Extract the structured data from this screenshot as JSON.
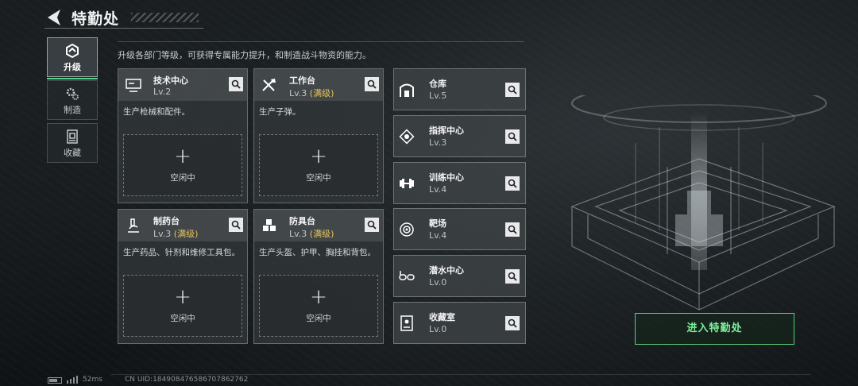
{
  "header": {
    "title": "特勤处"
  },
  "nav": [
    {
      "label": "升级",
      "icon": "upgrade-icon",
      "active": true
    },
    {
      "label": "制造",
      "icon": "gears-icon",
      "active": false
    },
    {
      "label": "收藏",
      "icon": "collection-icon",
      "active": false
    }
  ],
  "description": "升级各部门等级，可获得专属能力提升，和制造战斗物资的能力。",
  "cards": [
    {
      "name": "技术中心",
      "level": "Lv.2",
      "max": "",
      "desc": "生产枪械和配件。",
      "slot_label": "空闲中",
      "icon": "computer-icon"
    },
    {
      "name": "工作台",
      "level": "Lv.3",
      "max": "(满级)",
      "desc": "生产子弹。",
      "slot_label": "空闲中",
      "icon": "tools-icon"
    },
    {
      "name": "制药台",
      "level": "Lv.3",
      "max": "(满级)",
      "desc": "生产药品、针剂和维修工具包。",
      "slot_label": "空闲中",
      "icon": "microscope-icon"
    },
    {
      "name": "防具台",
      "level": "Lv.3",
      "max": "(满级)",
      "desc": "生产头盔、护甲、胸挂和背包。",
      "slot_label": "空闲中",
      "icon": "armor-boxes-icon"
    }
  ],
  "slot_plus": "+",
  "facilities": [
    {
      "name": "仓库",
      "level": "Lv.5",
      "icon": "warehouse-icon"
    },
    {
      "name": "指挥中心",
      "level": "Lv.3",
      "icon": "chip-icon"
    },
    {
      "name": "训练中心",
      "level": "Lv.4",
      "icon": "dumbbell-icon"
    },
    {
      "name": "靶场",
      "level": "Lv.4",
      "icon": "target-icon"
    },
    {
      "name": "潜水中心",
      "level": "Lv.0",
      "icon": "diving-goggles-icon"
    },
    {
      "name": "收藏室",
      "level": "Lv.0",
      "icon": "display-case-icon"
    }
  ],
  "enter_button": "进入特勤处",
  "footer": {
    "ping": "52ms",
    "uid": "CN UID:1849084765867078627​62"
  },
  "colors": {
    "accent_green": "#57d27b",
    "max_level_gold": "#e4c25a"
  }
}
